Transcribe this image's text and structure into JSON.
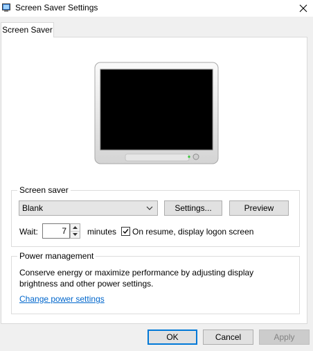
{
  "window": {
    "title": "Screen Saver Settings"
  },
  "tabs": [
    {
      "label": "Screen Saver"
    }
  ],
  "screensaver_group": {
    "label": "Screen saver",
    "selected": "Blank",
    "settings_label": "Settings...",
    "preview_label": "Preview",
    "wait_label": "Wait:",
    "wait_value": "7",
    "minutes_label": "minutes",
    "on_resume_label": "On resume, display logon screen",
    "on_resume_checked": true
  },
  "power_group": {
    "label": "Power management",
    "description_line1": "Conserve energy or maximize performance by adjusting display",
    "description_line2": "brightness and other power settings.",
    "link_label": "Change power settings"
  },
  "footer": {
    "ok_label": "OK",
    "cancel_label": "Cancel",
    "apply_label": "Apply"
  },
  "colors": {
    "accent": "#0078d7",
    "link": "#0066cc"
  }
}
